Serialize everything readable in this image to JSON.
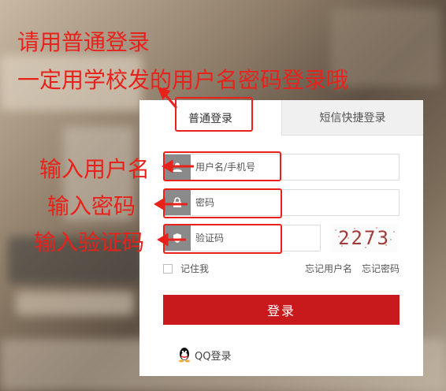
{
  "annotations": {
    "instruction_line1": "请用普通登录",
    "instruction_line2": "一定用学校发的用户名密码登录哦",
    "username_note": "输入用户名",
    "password_note": "输入密码",
    "captcha_note": "输入验证码"
  },
  "tabs": {
    "normal": "普通登录",
    "sms": "短信快捷登录"
  },
  "form": {
    "username_placeholder": "用户名/手机号",
    "password_placeholder": "密码",
    "captcha_placeholder": "验证码",
    "captcha_text": "2273",
    "remember_me": "记住我",
    "forgot_username": "忘记用户名",
    "forgot_password": "忘记密码",
    "login_button": "登录",
    "qq_login": "QQ登录"
  },
  "colors": {
    "accent": "#c8191c",
    "annotation": "#e8221b"
  },
  "icons": {
    "username": "user-icon",
    "password": "lock-icon",
    "captcha": "shield-icon",
    "qq": "qq-penguin-icon"
  }
}
